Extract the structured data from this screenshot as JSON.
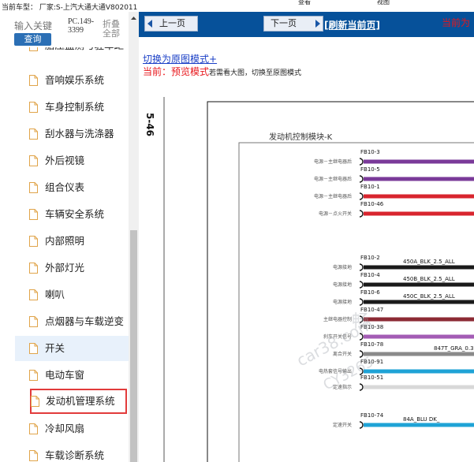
{
  "topbar": {
    "info": "当前车型：   厂家:S-上汽大通大通V802011",
    "buttons": [
      "查看",
      "视图"
    ]
  },
  "sidebar": {
    "search_placeholder": "输入关键",
    "search_button": "查询",
    "code": "PC.149-3399",
    "fold_label": "折叠全部",
    "items": [
      {
        "label": "胎压监测与驻车距"
      },
      {
        "label": "音响娱乐系统"
      },
      {
        "label": "车身控制系统"
      },
      {
        "label": "刮水器与洗涤器"
      },
      {
        "label": "外后视镜"
      },
      {
        "label": "组合仪表"
      },
      {
        "label": "车辆安全系统"
      },
      {
        "label": "内部照明"
      },
      {
        "label": "外部灯光"
      },
      {
        "label": "喇叭"
      },
      {
        "label": "点烟器与车载逆变"
      },
      {
        "label": "开关"
      },
      {
        "label": "电动车窗"
      },
      {
        "label": "发动机管理系统"
      },
      {
        "label": "冷却风扇"
      },
      {
        "label": "车载诊断系统"
      }
    ]
  },
  "nav": {
    "prev_label": "上一页",
    "next_label": "下一页",
    "refresh_label": "[刷新当前页]",
    "current_right": "当前为"
  },
  "content": {
    "mode_link": "切换为原图模式+",
    "current_prefix": "当前：",
    "current_mode": "预览模式",
    "current_hint": "若需看大图，切换至原图模式"
  },
  "diagram": {
    "page_number": "5-46",
    "module_title": "发动机控制模块-K",
    "pins": [
      {
        "pin": "FB10-3",
        "signal": "电源－主继电器后",
        "wire": "",
        "color": "#7a3a99"
      },
      {
        "pin": "FB10-5",
        "signal": "电源－主继电器后",
        "wire": "",
        "color": "#7a3a99"
      },
      {
        "pin": "FB10-1",
        "signal": "电源－主继电器后",
        "wire": "",
        "color": "#d8252e"
      },
      {
        "pin": "FB10-46",
        "signal": "电源－点火开关",
        "wire": "",
        "color": "#d8252e"
      },
      {
        "pin": "FB10-2",
        "signal": "电源接地",
        "wire": "450A_BLK_2.5_ALL",
        "color": "#1a1a1a"
      },
      {
        "pin": "FB10-4",
        "signal": "电源接地",
        "wire": "450B_BLK_2.5_ALL",
        "color": "#1a1a1a"
      },
      {
        "pin": "FB10-6",
        "signal": "电源接地",
        "wire": "450C_BLK_2.5_ALL",
        "color": "#1a1a1a"
      },
      {
        "pin": "FB10-47",
        "signal": "主继电器控制",
        "wire": "",
        "color": "#8c2a34"
      },
      {
        "pin": "FB10-38",
        "signal": "刹车开关信号",
        "wire": "",
        "color": "#a35cb5"
      },
      {
        "pin": "FB10-78",
        "signal": "离合开关",
        "wire": "847T_GRA_0.3",
        "color": "#8a8a8a"
      },
      {
        "pin": "FB10-91",
        "signal": "电热套信号输出",
        "wire": "",
        "color": "#1fa3d6"
      },
      {
        "pin": "FB10-51",
        "signal": "定速指示",
        "wire": "",
        "color": "#d8d8d8"
      },
      {
        "pin": "FB10-74",
        "signal": "定速开关",
        "wire": "84A_BLU DK_",
        "color": "#1fa3d6"
      }
    ],
    "watermark_lines": [
      "畅",
      "car38.com",
      "CY3265"
    ]
  }
}
